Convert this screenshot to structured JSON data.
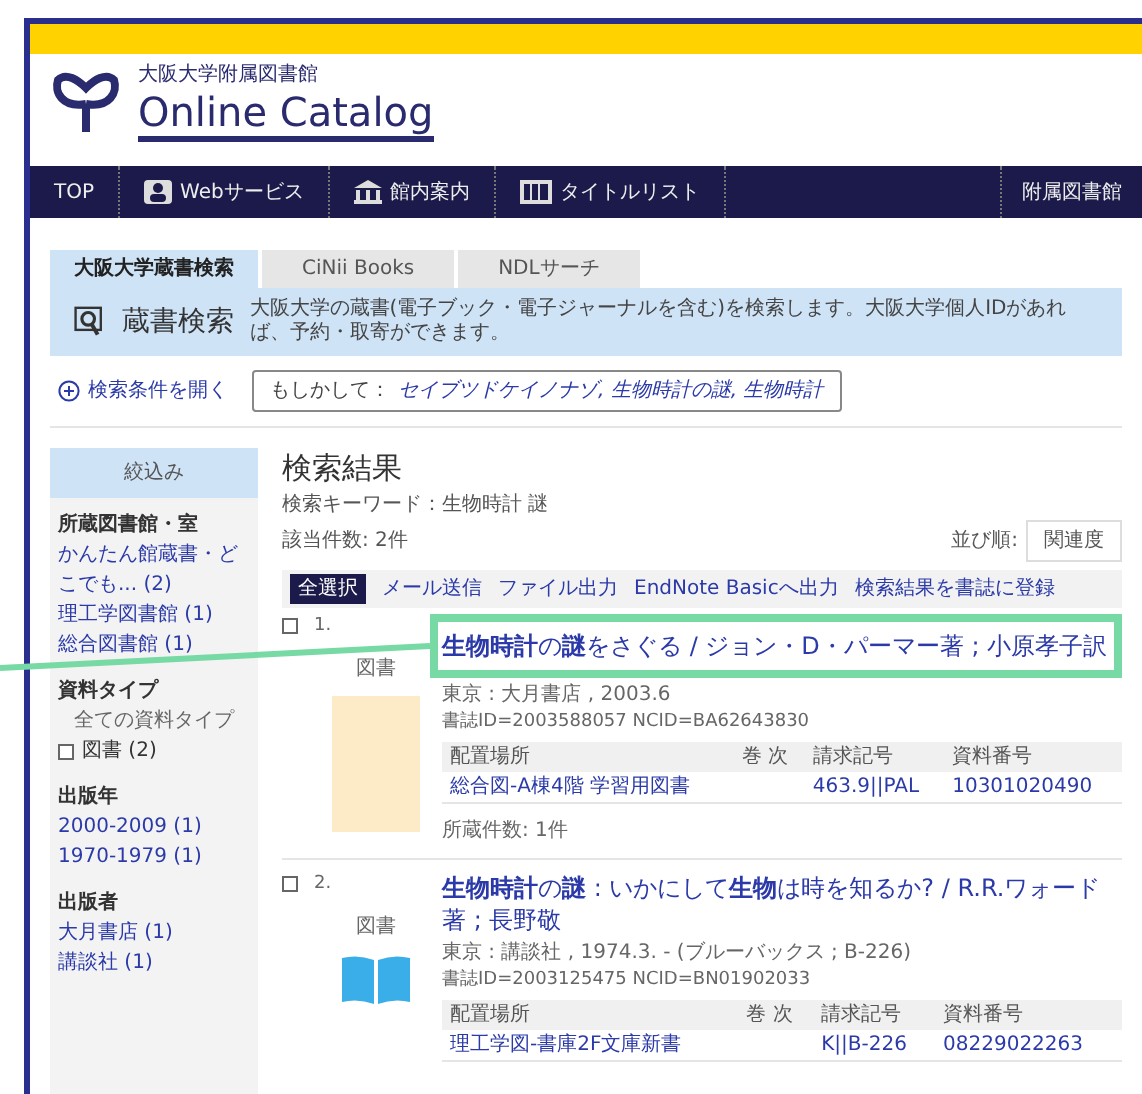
{
  "header": {
    "subtitle": "大阪大学附属図書館",
    "title": "Online Catalog"
  },
  "nav": {
    "items": [
      {
        "label": "TOP",
        "kind": "text"
      },
      {
        "label": "Webサービス",
        "kind": "person"
      },
      {
        "label": "館内案内",
        "kind": "building"
      },
      {
        "label": "タイトルリスト",
        "kind": "shelf"
      }
    ],
    "right": "附属図書館"
  },
  "tabs": [
    {
      "label": "大阪大学蔵書検索",
      "selected": true
    },
    {
      "label": "CiNii Books",
      "selected": false
    },
    {
      "label": "NDLサーチ",
      "selected": false
    }
  ],
  "banner": {
    "title": "蔵書検索",
    "description": "大阪大学の蔵書(電子ブック・電子ジャーナルを含む)を検索します。大阪大学個人IDがあれば、予約・取寄ができます。"
  },
  "open_conditions": "検索条件を開く",
  "suggestion": {
    "label": "もしかして：",
    "text": "セイブツドケイノナゾ, 生物時計の謎, 生物時計"
  },
  "sidebar": {
    "title": "絞込み",
    "sections": [
      {
        "title": "所蔵図書館・室",
        "items": [
          {
            "label": "かんたん館蔵書・どこでも... (2)",
            "kind": "link"
          },
          {
            "label": "理工学図書館 (1)",
            "kind": "link"
          },
          {
            "label": "総合図書館 (1)",
            "kind": "link"
          }
        ]
      },
      {
        "title": "資料タイプ",
        "items": [
          {
            "label": "全ての資料タイプ",
            "kind": "all"
          },
          {
            "label": "図書 (2)",
            "kind": "check",
            "checked": false
          }
        ]
      },
      {
        "title": "出版年",
        "items": [
          {
            "label": "2000-2009 (1)",
            "kind": "link"
          },
          {
            "label": "1970-1979 (1)",
            "kind": "link"
          }
        ]
      },
      {
        "title": "出版者",
        "items": [
          {
            "label": "大月書店 (1)",
            "kind": "link"
          },
          {
            "label": "講談社 (1)",
            "kind": "link"
          }
        ]
      }
    ]
  },
  "results": {
    "title": "検索結果",
    "keyword": "検索キーワード：生物時計 謎",
    "count": "該当件数: 2件",
    "sort_label": "並び順:",
    "sort_value": "関連度",
    "select_all": "全選択",
    "toolbar": [
      "メール送信",
      "ファイル出力",
      "EndNote Basicへ出力",
      "検索結果を書誌に登録"
    ],
    "items": [
      {
        "number": "1.",
        "checked": false,
        "type": "図書",
        "cover": {
          "kind": "placeholder"
        },
        "highlighted": true,
        "columns": [
          "配置場所",
          "巻 次",
          "請求記号",
          "資料番号"
        ],
        "title": "**生物時計**の**謎**をさぐる / ジョン・D・パーマー著 ; 小原孝子訳",
        "publisher": "東京 : 大月書店 , 2003.6",
        "ids": "書誌ID=2003588057 NCID=BA62643830",
        "holdings": [
          {
            "location": "総合図-A棟4階 学習用図書",
            "call_number": "463.9||PAL",
            "item_number": "10301020490"
          }
        ],
        "holding_count": "所蔵件数: 1件"
      },
      {
        "number": "2.",
        "checked": false,
        "type": "図書",
        "cover": {
          "kind": "book"
        },
        "highlighted": false,
        "columns": [
          "配置場所",
          "巻 次",
          "請求記号",
          "資料番号"
        ],
        "title": "**生物時計**の**謎** : いかにして**生物**は時を知るか? / R.R.ワォード著 ; 長野敬",
        "publisher": "東京 : 講談社 , 1974.3. - (ブルーバックス ; B-226)",
        "ids": "書誌ID=2003125475 NCID=BN01902033",
        "holdings": [
          {
            "location": "理工学図-書庫2F文庫新書",
            "call_number": "K||B-226",
            "item_number": "08229022263"
          }
        ]
      }
    ]
  }
}
